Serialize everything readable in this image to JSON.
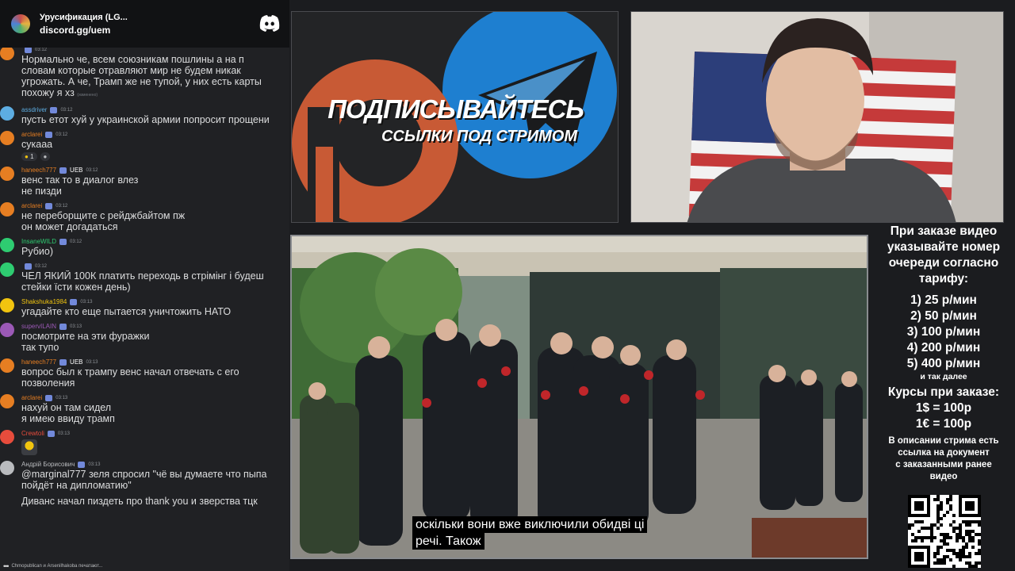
{
  "discord": {
    "server_name": "Урусификация (LG...",
    "server_link": "discord.gg/uem"
  },
  "messages": [
    {
      "user": "",
      "time": "03:12",
      "lines": [
        "Нормально че, всем союзникам пошлины а на п",
        "словам которые отравляют мир не будем никак",
        "угрожать. А че, Трамп же не тупой, у них есть карты",
        "похожу я хз"
      ],
      "edited": "(изменено)",
      "color": "#e67e22"
    },
    {
      "user": "assdriver",
      "time": "03:12",
      "lines": [
        "пусть етот хуй у украинской армии попросит прощени"
      ],
      "color": "#5dade2"
    },
    {
      "user": "arclarei",
      "time": "03:12",
      "lines": [
        "сукааа"
      ],
      "reactions": [
        "1",
        ""
      ],
      "color": "#e67e22"
    },
    {
      "user": "haneech777",
      "badge": "UEB",
      "time": "03:12",
      "lines": [
        "венс так то в диалог влез",
        "не пизди"
      ],
      "color": "#e67e22"
    },
    {
      "user": "arclarei",
      "time": "03:12",
      "lines": [
        "не переборщите с рейджбайтом пж",
        "он может догадаться"
      ],
      "color": "#e67e22"
    },
    {
      "user": "InsaneWILD",
      "time": "03:12",
      "lines": [
        "Рубио)"
      ],
      "color": "#2ecc71"
    },
    {
      "user": "",
      "time": "03:12",
      "lines": [
        "ЧЕЛ ЯКИЙ 100К платить переходь в стрімінг і будеш",
        "стейки їсти кожен день)"
      ],
      "color": "#2ecc71"
    },
    {
      "user": "Shakshuka1984",
      "time": "03:13",
      "lines": [
        "угадайте кто еще пытается уничтожить НАТО"
      ],
      "color": "#f1c40f"
    },
    {
      "user": "supervILAIN",
      "time": "03:13",
      "lines": [
        "посмотрите на эти фуражки",
        "так тупо"
      ],
      "color": "#9b59b6"
    },
    {
      "user": "haneech777",
      "badge": "UEB",
      "time": "03:13",
      "lines": [
        "вопрос был к трампу венс начал отвечать с его",
        "позволения"
      ],
      "color": "#e67e22"
    },
    {
      "user": "arclarei",
      "time": "03:13",
      "lines": [
        "нахуй он там сидел",
        "я имею ввиду трамп"
      ],
      "color": "#e67e22"
    },
    {
      "user": "Crewtoli",
      "time": "03:13",
      "lines": [],
      "sticker": true,
      "color": "#e74c3c"
    },
    {
      "user": "Андрій Борисович",
      "time": "03:13",
      "lines": [
        "@marginal777 зеля спросил \"чё вы думаете что пыпа",
        "пойдёт на дипломатию\""
      ],
      "color": "#b9bbbe"
    },
    {
      "user": "",
      "time": "",
      "lines": [
        "Диванс начал пиздеть про thank you и зверства тцк"
      ],
      "color": "#b9bbbe"
    }
  ],
  "typing": "Chmopublican и Arsenilhakoba печатают...",
  "promo": {
    "title": "ПОДПИСЫВАЙТЕСЬ",
    "subtitle": "ССЫЛКИ ПОД СТРИМОМ"
  },
  "video": {
    "subtitle_line1": "оскільки вони вже виключили обидві ці",
    "subtitle_line2": "речі.  Також"
  },
  "info": {
    "heading": [
      "При заказе видео",
      "указывайте номер",
      "очереди согласно",
      "тарифу:"
    ],
    "tariffs": [
      "1) 25 р/мин",
      "2) 50 р/мин",
      "3) 100 р/мин",
      "4) 200 р/мин",
      "5) 400 р/мин"
    ],
    "etc": "и так далее",
    "rates_title": "Курсы при заказе:",
    "rates": [
      "1$ = 100р",
      "1€ = 100р"
    ],
    "description": [
      "В описании стрима есть",
      "ссылка на документ",
      "с заказанными ранее",
      "видео"
    ]
  },
  "colors": {
    "discord_blurple": "#5865f2",
    "chat_bg": "#202124",
    "telegram_blue": "#1e88e5",
    "patreon_red": "#e06a3c"
  }
}
